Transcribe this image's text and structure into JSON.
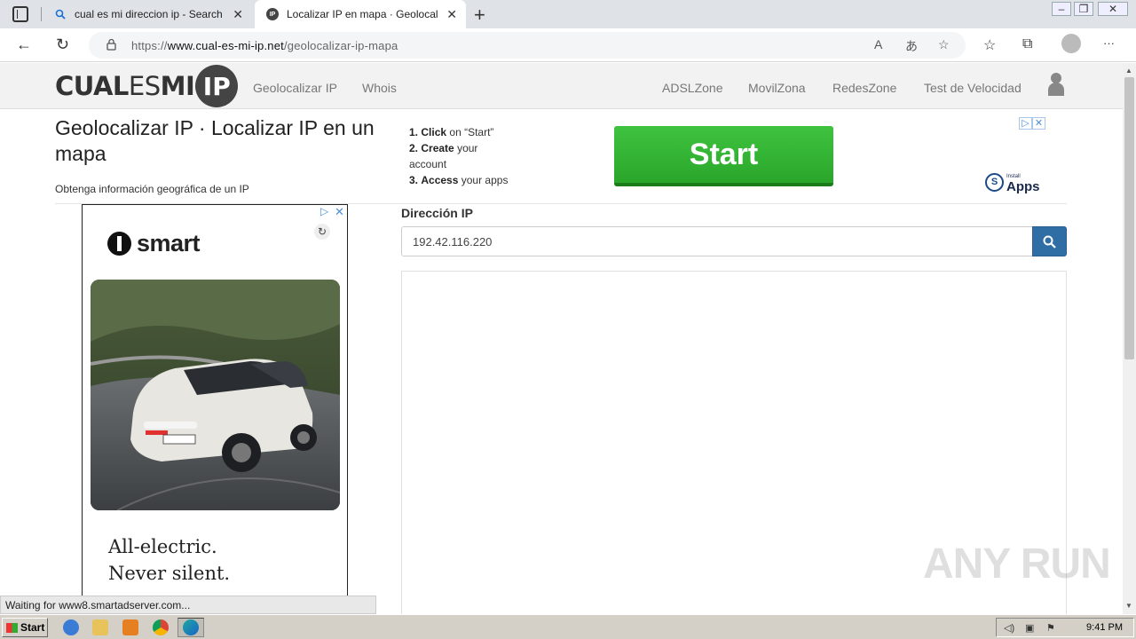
{
  "browser": {
    "tabs": [
      {
        "title": "cual es mi direccion ip - Search",
        "active": false
      },
      {
        "title": "Localizar IP en mapa · Geolocalizar",
        "active": true
      }
    ],
    "url_prefix": "https://",
    "url_domain": "www.cual-es-mi-ip.net",
    "url_path": "/geolocalizar-ip-mapa",
    "icons": {
      "tab_actions": "tab-actions-icon",
      "back": "back-arrow-icon",
      "reload": "reload-icon",
      "lock": "lock-icon",
      "read_aloud": "read-aloud-icon",
      "translate": "translate-icon",
      "add_favorite": "add-favorite-icon",
      "favorites": "favorites-icon",
      "collections": "collections-icon",
      "profile": "profile-icon",
      "more": "more-icon"
    },
    "glyphs": {
      "close": "✕",
      "new_tab": "+",
      "back": "←",
      "reload": "↻",
      "more": "···",
      "search": "🔍",
      "ip_favicon": "IP"
    }
  },
  "site": {
    "logo_bold": "CUAL",
    "logo_mid": "ES",
    "logo_bold2": "MI",
    "logo_circle": "IP",
    "nav_left": [
      "Geolocalizar IP",
      "Whois"
    ],
    "nav_right": [
      "ADSLZone",
      "MovilZona",
      "RedesZone",
      "Test de Velocidad"
    ]
  },
  "page": {
    "title": "Geolocalizar IP · Localizar IP en un mapa",
    "subtitle": "Obtenga información geográfica de un IP",
    "ip_label": "Dirección IP",
    "ip_value": "192.42.116.220"
  },
  "top_ad": {
    "step1_num": "1.",
    "step1_bold": "Click",
    "step1_rest": "on “Start”",
    "step2_num": "2.",
    "step2_bold": "Create",
    "step2_rest": "your account",
    "step3_num": "3.",
    "step3_bold": "Access",
    "step3_rest": "your apps",
    "button": "Start",
    "install_small": "Install",
    "install_big": "Apps",
    "install_logo": "S"
  },
  "side_ad": {
    "brand": "smart",
    "tagline_1": "All-electric.",
    "tagline_2": "Never silent.",
    "plate": "BL-JC 3201"
  },
  "status": {
    "text": "Waiting for www8.smartadserver.com..."
  },
  "watermark": "ANY RUN",
  "taskbar": {
    "start": "Start",
    "clock": "9:41 PM"
  },
  "colors": {
    "start_green": "#2aa62a",
    "search_blue": "#2f6ea5",
    "tab_bar": "#dfe3e8"
  }
}
